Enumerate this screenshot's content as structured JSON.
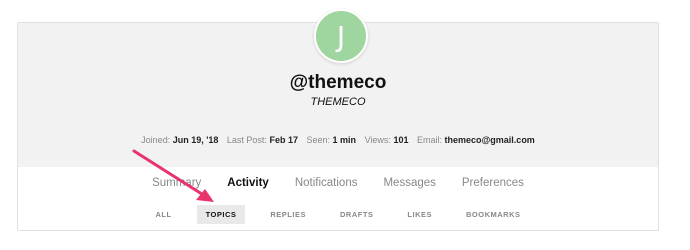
{
  "profile": {
    "avatar_letter": "J",
    "avatar_color": "#9fd59f",
    "username": "@themeco",
    "full_name": "THEMECO"
  },
  "stats": {
    "joined_label": "Joined:",
    "joined_value": "Jun 19, '18",
    "last_post_label": "Last Post:",
    "last_post_value": "Feb 17",
    "seen_label": "Seen:",
    "seen_value": "1 min",
    "views_label": "Views:",
    "views_value": "101",
    "email_label": "Email:",
    "email_value": "themeco@gmail.com"
  },
  "tabs": [
    {
      "label": "Summary",
      "active": false
    },
    {
      "label": "Activity",
      "active": true
    },
    {
      "label": "Notifications",
      "active": false
    },
    {
      "label": "Messages",
      "active": false
    },
    {
      "label": "Preferences",
      "active": false
    }
  ],
  "subtabs": [
    {
      "label": "ALL",
      "active": false
    },
    {
      "label": "TOPICS",
      "active": true
    },
    {
      "label": "REPLIES",
      "active": false
    },
    {
      "label": "DRAFTS",
      "active": false
    },
    {
      "label": "LIKES",
      "active": false
    },
    {
      "label": "BOOKMARKS",
      "active": false
    }
  ],
  "annotation": {
    "arrow_color": "#e8336d",
    "icon": "arrow-annotation-icon"
  }
}
